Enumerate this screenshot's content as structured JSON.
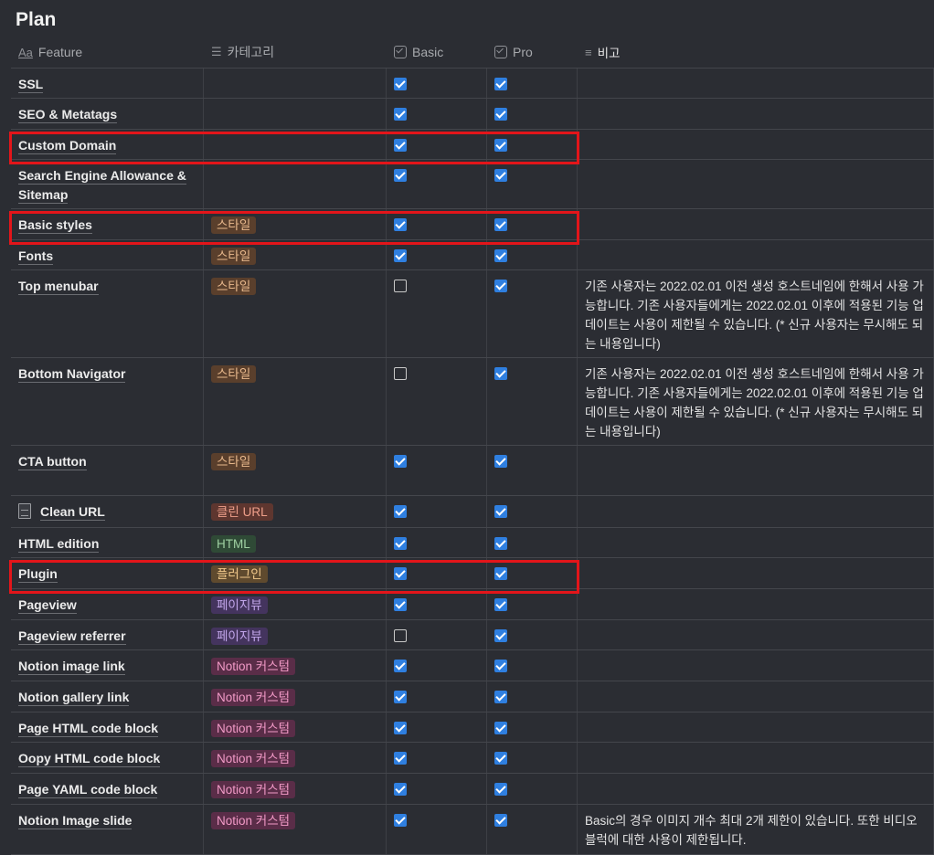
{
  "page": {
    "title": "Plan"
  },
  "columns": [
    {
      "label": "Feature",
      "icon": "text-property-icon"
    },
    {
      "label": "카테고리",
      "icon": "list-property-icon"
    },
    {
      "label": "Basic",
      "icon": "checkbox-property-icon"
    },
    {
      "label": "Pro",
      "icon": "checkbox-property-icon"
    },
    {
      "label": "비고",
      "icon": "text-align-icon"
    }
  ],
  "tag_colors": {
    "style": {
      "bg": "#5a3f2c",
      "fg": "#e8b88c"
    },
    "cleanurl": {
      "bg": "#5e362f",
      "fg": "#ef9f8a"
    },
    "html": {
      "bg": "#2f4a36",
      "fg": "#9fd0a2"
    },
    "plugin": {
      "bg": "#5f4a2e",
      "fg": "#f0c88a"
    },
    "pageview": {
      "bg": "#44345e",
      "fg": "#c3a7ec"
    },
    "notion": {
      "bg": "#5a2d48",
      "fg": "#f29ac7"
    }
  },
  "rows": [
    {
      "feature": "SSL",
      "category": "",
      "tag": "",
      "basic": true,
      "pro": true,
      "note": ""
    },
    {
      "feature": "SEO & Metatags",
      "category": "",
      "tag": "",
      "basic": true,
      "pro": true,
      "note": ""
    },
    {
      "feature": "Custom Domain",
      "category": "",
      "tag": "",
      "basic": true,
      "pro": true,
      "note": "",
      "highlighted": true
    },
    {
      "feature": "Search Engine Allowance & Sitemap",
      "category": "",
      "tag": "",
      "basic": true,
      "pro": true,
      "note": ""
    },
    {
      "feature": "Basic styles",
      "category": "스타일",
      "tag": "style",
      "basic": true,
      "pro": true,
      "note": "",
      "highlighted": true
    },
    {
      "feature": "Fonts",
      "category": "스타일",
      "tag": "style",
      "basic": true,
      "pro": true,
      "note": ""
    },
    {
      "feature": "Top menubar",
      "category": "스타일",
      "tag": "style",
      "basic": false,
      "pro": true,
      "note": "기존 사용자는 2022.02.01 이전 생성 호스트네임에 한해서 사용 가능합니다. 기존 사용자들에게는 2022.02.01 이후에 적용된 기능 업데이트는 사용이 제한될 수 있습니다. (* 신규 사용자는 무시해도 되는 내용입니다)"
    },
    {
      "feature": "Bottom Navigator",
      "category": "스타일",
      "tag": "style",
      "basic": false,
      "pro": true,
      "note": "기존 사용자는 2022.02.01 이전 생성 호스트네임에 한해서 사용 가능합니다. 기존 사용자들에게는 2022.02.01 이후에 적용된 기능 업데이트는 사용이 제한될 수 있습니다. (* 신규 사용자는 무시해도 되는 내용입니다)"
    },
    {
      "feature": "CTA button",
      "category": "스타일",
      "tag": "style",
      "basic": true,
      "pro": true,
      "note": ""
    },
    {
      "feature": "Clean URL",
      "category": "클린 URL",
      "tag": "cleanurl",
      "basic": true,
      "pro": true,
      "note": "",
      "page_icon": true
    },
    {
      "feature": "HTML edition",
      "category": "HTML",
      "tag": "html",
      "basic": true,
      "pro": true,
      "note": ""
    },
    {
      "feature": "Plugin",
      "category": "플러그인",
      "tag": "plugin",
      "basic": true,
      "pro": true,
      "note": "",
      "highlighted": true
    },
    {
      "feature": "Pageview",
      "category": "페이지뷰",
      "tag": "pageview",
      "basic": true,
      "pro": true,
      "note": ""
    },
    {
      "feature": "Pageview referrer",
      "category": "페이지뷰",
      "tag": "pageview",
      "basic": false,
      "pro": true,
      "note": ""
    },
    {
      "feature": "Notion image link",
      "category": "Notion 커스텀",
      "tag": "notion",
      "basic": true,
      "pro": true,
      "note": ""
    },
    {
      "feature": "Notion gallery link",
      "category": "Notion 커스텀",
      "tag": "notion",
      "basic": true,
      "pro": true,
      "note": ""
    },
    {
      "feature": "Page HTML code block",
      "category": "Notion 커스텀",
      "tag": "notion",
      "basic": true,
      "pro": true,
      "note": ""
    },
    {
      "feature": "Oopy HTML code block",
      "category": "Notion 커스텀",
      "tag": "notion",
      "basic": true,
      "pro": true,
      "note": ""
    },
    {
      "feature": "Page YAML code block",
      "category": "Notion 커스텀",
      "tag": "notion",
      "basic": true,
      "pro": true,
      "note": ""
    },
    {
      "feature": "Notion Image slide",
      "category": "Notion 커스텀",
      "tag": "notion",
      "basic": true,
      "pro": true,
      "note": "Basic의 경우 이미지 개수 최대 2개 제한이 있습니다. 또한 비디오 블럭에 대한 사용이 제한됩니다."
    }
  ],
  "highlight_color": "#e3151a"
}
